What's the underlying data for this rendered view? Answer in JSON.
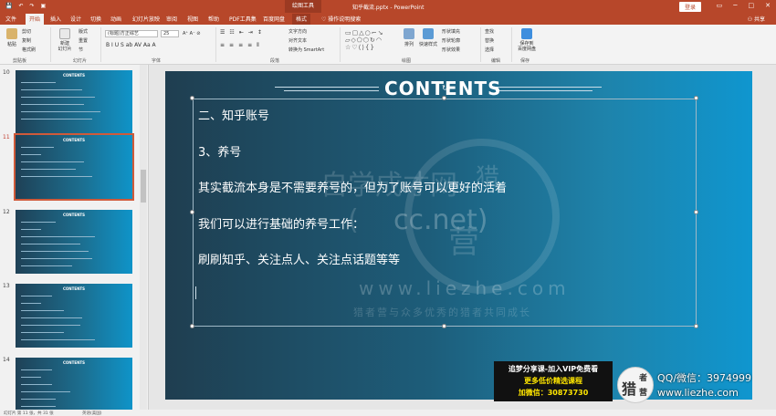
{
  "titlebar": {
    "context_label": "绘图工具",
    "doc_title": "知乎截流.pptx  -  PowerPoint",
    "login_label": "登录",
    "quick_access": [
      "💾",
      "↶",
      "↷",
      "▣"
    ]
  },
  "tabs": [
    "文件",
    "开始",
    "插入",
    "设计",
    "切换",
    "动画",
    "幻灯片放映",
    "审阅",
    "视图",
    "帮助",
    "PDF工具集",
    "百度网盘",
    "格式"
  ],
  "active_tab": "开始",
  "tell_me": "操作说明搜索",
  "share_label": "共享",
  "ribbon": {
    "clipboard": {
      "label": "剪贴板",
      "paste": "粘贴",
      "cut": "剪切",
      "copy": "复制",
      "format_painter": "格式刷"
    },
    "slides": {
      "label": "幻灯片",
      "new_slide": "新建\n幻灯片",
      "layout": "版式",
      "reset": "重置",
      "section": "节"
    },
    "font": {
      "label": "字体",
      "font_name": "(标题)方正综艺",
      "font_size": "25",
      "row2": "B  I  U  S  ab  AV  Aa  A",
      "row1b": "A⁺ A⁻ ⊘"
    },
    "paragraph": {
      "label": "段落",
      "text_direction": "文字方向",
      "align_text": "对齐文本",
      "smartart": "转换为 SmartArt"
    },
    "drawing": {
      "label": "绘图",
      "arrange": "排列",
      "quick_styles": "快速样式",
      "fill": "形状填充",
      "outline": "形状轮廓",
      "effects": "形状效果"
    },
    "editing": {
      "label": "编辑",
      "find": "查找",
      "replace": "替换",
      "select": "选择"
    },
    "save": {
      "label": "保存",
      "save_to_cloud": "保存到\n百度网盘"
    }
  },
  "thumbnails": [
    {
      "num": "10",
      "title": "CONTENTS",
      "lines": [
        0.34,
        0.6,
        0.72,
        0.62,
        0.78,
        0.7
      ]
    },
    {
      "num": "11",
      "title": "CONTENTS",
      "lines": [
        0.32,
        0.2,
        0.62,
        0.54,
        0.7
      ]
    },
    {
      "num": "12",
      "title": "CONTENTS",
      "lines": [
        0.34,
        0.2,
        0.72,
        0.58,
        0.66,
        0.7,
        0.5
      ]
    },
    {
      "num": "13",
      "title": "CONTENTS",
      "lines": [
        0.3,
        0.2,
        0.42,
        0.6,
        0.58,
        0.42,
        0.72
      ]
    },
    {
      "num": "14",
      "title": "CONTENTS",
      "lines": [
        0.3,
        0.2,
        0.3,
        0.48,
        0.34,
        0.34
      ]
    }
  ],
  "slide": {
    "title": "CONTENTS",
    "lines": [
      "二、知乎账号",
      "3、养号",
      "其实截流本身是不需要养号的，但为了账号可以更好的活着",
      "我们可以进行基础的养号工作：",
      "刷刷知乎、关注点人、关注点话题等等"
    ],
    "watermark": {
      "brand": "自学成才网",
      "domain_a": "(",
      "domain_b": "cc.net)",
      "url": "www.liezhe.com",
      "slogan": "猎者营与众多优秀的猎者共同成长",
      "logo_a": "猎",
      "logo_b": "营"
    }
  },
  "overlay": {
    "promo_line1": "追梦分享课-加入VIP免费看",
    "promo_line2": "更多低价精选课程",
    "promo_line3": "加微信：30873730",
    "logo_char1": "猎",
    "logo_char2": "者",
    "logo_char3": "营",
    "qq": "QQ/微信：3974999",
    "site": "www.liezhe.com"
  },
  "status": {
    "slide_info": "幻灯片 第 11 张，共 31 张",
    "language": "英语(美国)"
  },
  "colors": {
    "accent": "#b7472a",
    "slide_left": "#1f3e50",
    "slide_right": "#0f96cf",
    "promo_yellow": "#ffe600"
  }
}
